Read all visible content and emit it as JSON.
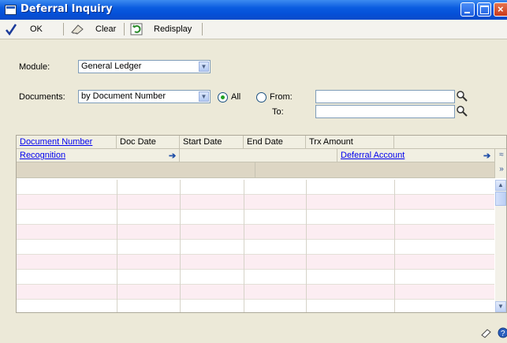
{
  "window": {
    "title": "Deferral Inquiry"
  },
  "toolbar": {
    "ok_label": "OK",
    "clear_label": "Clear",
    "redisplay_label": "Redisplay"
  },
  "form": {
    "module_label": "Module:",
    "module_value": "General Ledger",
    "documents_label": "Documents:",
    "documents_value": "by Document Number",
    "radio_all_label": "All",
    "radio_all_selected": true,
    "radio_from_label": "From:",
    "to_label": "To:",
    "from_value": "",
    "to_value": ""
  },
  "grid": {
    "columns": [
      "Document Number",
      "Doc Date",
      "Start Date",
      "End Date",
      "Trx Amount"
    ],
    "row2": {
      "recognition_label": "Recognition",
      "deferral_account_label": "Deferral Account"
    },
    "rows": [
      [
        "",
        "",
        "",
        "",
        ""
      ],
      [
        "",
        "",
        "",
        "",
        ""
      ],
      [
        "",
        "",
        "",
        "",
        ""
      ],
      [
        "",
        "",
        "",
        "",
        ""
      ],
      [
        "",
        "",
        "",
        "",
        ""
      ],
      [
        "",
        "",
        "",
        "",
        ""
      ],
      [
        "",
        "",
        "",
        "",
        ""
      ],
      [
        "",
        "",
        "",
        "",
        ""
      ],
      [
        "",
        "",
        "",
        "",
        ""
      ]
    ]
  },
  "icons": {
    "ok": "checkmark-icon",
    "clear": "eraser-icon",
    "redisplay": "refresh-icon",
    "lookup": "magnifier-icon",
    "status_note": "note-icon",
    "status_help": "help-icon"
  },
  "colors": {
    "title_bar": "#0a5ce0",
    "row_alt": "#fcedf2",
    "link": "#0000ee"
  }
}
